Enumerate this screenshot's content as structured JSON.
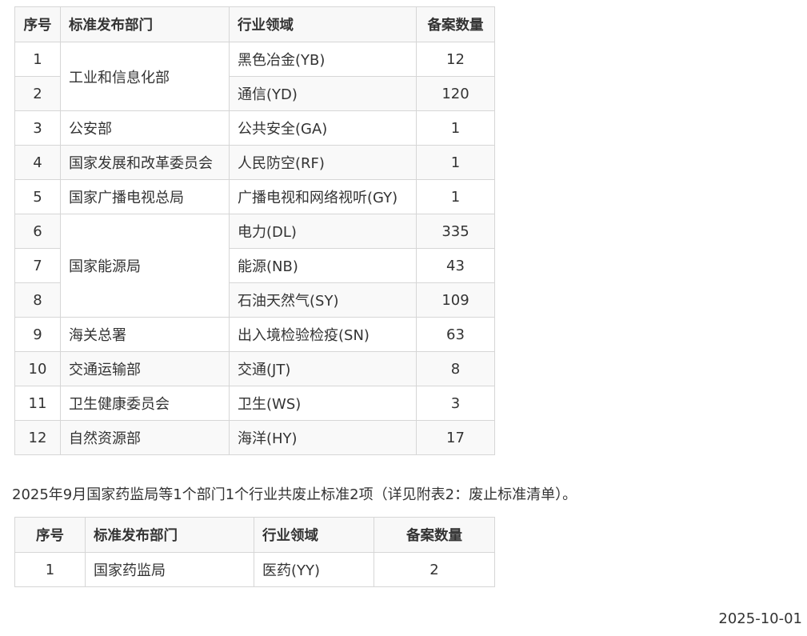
{
  "table1": {
    "headers": [
      "序号",
      "标准发布部门",
      "行业领域",
      "备案数量"
    ],
    "rows": [
      {
        "idx": "1",
        "dept": "工业和信息化部",
        "field": "黑色冶金(YB)",
        "count": "12"
      },
      {
        "idx": "2",
        "dept": "",
        "field": "通信(YD)",
        "count": "120"
      },
      {
        "idx": "3",
        "dept": "公安部",
        "field": "公共安全(GA)",
        "count": "1"
      },
      {
        "idx": "4",
        "dept": "国家发展和改革委员会",
        "field": "人民防空(RF)",
        "count": "1"
      },
      {
        "idx": "5",
        "dept": "国家广播电视总局",
        "field": "广播电视和网络视听(GY)",
        "count": "1"
      },
      {
        "idx": "6",
        "dept": "国家能源局",
        "field": "电力(DL)",
        "count": "335"
      },
      {
        "idx": "7",
        "dept": "",
        "field": "能源(NB)",
        "count": "43"
      },
      {
        "idx": "8",
        "dept": "",
        "field": "石油天然气(SY)",
        "count": "109"
      },
      {
        "idx": "9",
        "dept": "海关总署",
        "field": "出入境检验检疫(SN)",
        "count": "63"
      },
      {
        "idx": "10",
        "dept": "交通运输部",
        "field": "交通(JT)",
        "count": "8"
      },
      {
        "idx": "11",
        "dept": "卫生健康委员会",
        "field": "卫生(WS)",
        "count": "3"
      },
      {
        "idx": "12",
        "dept": "自然资源部",
        "field": "海洋(HY)",
        "count": "17"
      }
    ]
  },
  "note": "2025年9月国家药监局等1个部门1个行业共废止标准2项（详见附表2：废止标准清单）。",
  "table2": {
    "headers": [
      "序号",
      "标准发布部门",
      "行业领域",
      "备案数量"
    ],
    "rows": [
      {
        "idx": "1",
        "dept": "国家药监局",
        "field": "医药(YY)",
        "count": "2"
      }
    ]
  },
  "date": "2025-10-01"
}
